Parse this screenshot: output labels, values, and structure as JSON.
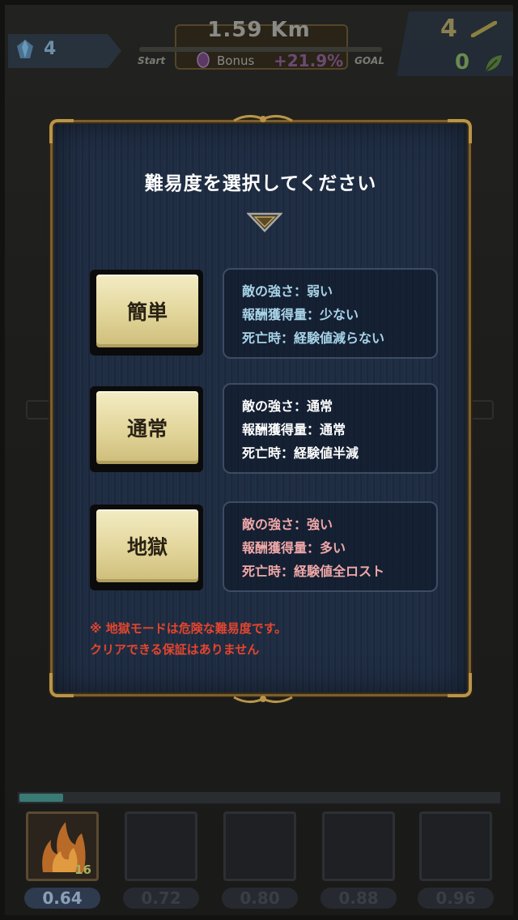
{
  "hud": {
    "crystals": "4",
    "distance": "1.59 Km",
    "start_label": "Start",
    "goal_label": "GOAL",
    "bonus_label": "Bonus",
    "bonus_value": "+21.9%",
    "keys": "4",
    "leaves": "0"
  },
  "dialog": {
    "title": "難易度を選択してください",
    "options": [
      {
        "label": "簡単",
        "info_color": "#a8d4e8",
        "lines": [
          "敵の強さ：弱い",
          "報酬獲得量：少ない",
          "死亡時：経験値減らない"
        ]
      },
      {
        "label": "通常",
        "info_color": "#ffffff",
        "lines": [
          "敵の強さ：通常",
          "報酬獲得量：通常",
          "死亡時：経験値半減"
        ]
      },
      {
        "label": "地獄",
        "info_color": "#f0a8a8",
        "lines": [
          "敵の強さ：強い",
          "報酬獲得量：多い",
          "死亡時：経験値全ロスト"
        ]
      }
    ],
    "warning": [
      "※ 地獄モードは危険な難易度です。",
      "クリアできる保証はありません"
    ]
  },
  "bottom": {
    "exp_progress": 0.09,
    "slots": [
      {
        "level": "16",
        "cost": "0.64",
        "active": true,
        "icon": "flame-icon"
      },
      {
        "level": "",
        "cost": "0.72",
        "active": false,
        "icon": ""
      },
      {
        "level": "",
        "cost": "0.80",
        "active": false,
        "icon": ""
      },
      {
        "level": "",
        "cost": "0.88",
        "active": false,
        "icon": ""
      },
      {
        "level": "",
        "cost": "0.96",
        "active": false,
        "icon": ""
      }
    ]
  }
}
